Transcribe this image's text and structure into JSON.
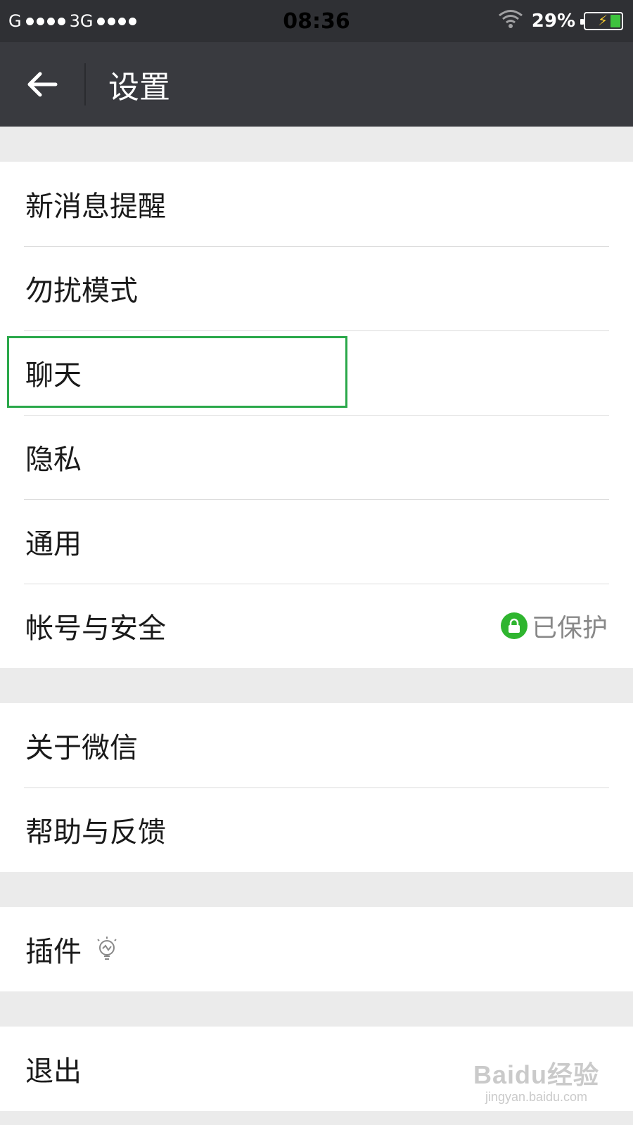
{
  "status_bar": {
    "carrier1": "G",
    "carrier2": "3G",
    "time": "08:36",
    "battery": "29%",
    "battery_level": 0.29
  },
  "header": {
    "title": "设置",
    "back_icon": "arrow-left-icon"
  },
  "groups": [
    {
      "items": [
        {
          "label": "新消息提醒"
        },
        {
          "label": "勿扰模式"
        },
        {
          "label": "聊天"
        },
        {
          "label": "隐私"
        },
        {
          "label": "通用"
        },
        {
          "label": "帐号与安全",
          "status": "已保护",
          "status_icon": "lock-icon",
          "status_color": "#2fb52f"
        }
      ]
    },
    {
      "items": [
        {
          "label": "关于微信"
        },
        {
          "label": "帮助与反馈"
        }
      ]
    },
    {
      "items": [
        {
          "label": "插件",
          "icon": "lightbulb-icon"
        }
      ]
    },
    {
      "items": [
        {
          "label": "退出"
        }
      ]
    }
  ],
  "watermark": {
    "logo": "Baidu经验",
    "url": "jingyan.baidu.com"
  }
}
